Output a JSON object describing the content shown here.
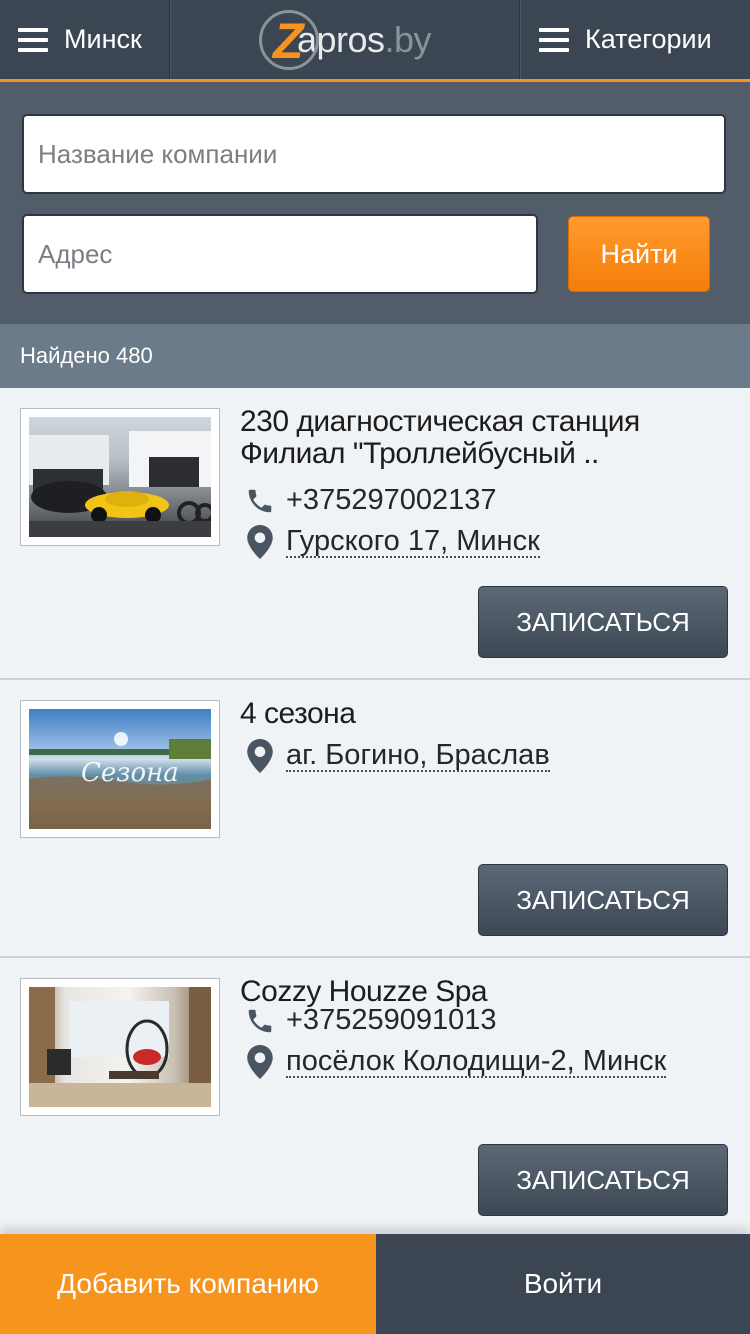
{
  "header": {
    "city_label": "Минск",
    "logo_z": "Z",
    "logo_text": "apros",
    "logo_domain": ".by",
    "categories_label": "Категории"
  },
  "search": {
    "name_placeholder": "Название компании",
    "address_placeholder": "Адрес",
    "find_label": "Найти"
  },
  "results": {
    "found_label": "Найдено 480"
  },
  "companies": [
    {
      "title": "230 диагностическая станция Филиал \"Троллейбусный ..",
      "phone": "+375297002137",
      "address": "Гурского 17, Минск",
      "button": "ЗАПИСАТЬСЯ"
    },
    {
      "title": "4 сезона",
      "address": "аг. Богино, Браслав",
      "button": "ЗАПИСАТЬСЯ",
      "image_caption": "Сезона"
    },
    {
      "title": "Cozzy Houzze Spa",
      "phone": "+375259091013",
      "address": "посёлок Колодищи-2, Минск",
      "button": "ЗАПИСАТЬСЯ"
    }
  ],
  "footer": {
    "add_company": "Добавить компанию",
    "login": "Войти"
  },
  "colors": {
    "header_bg": "#3c4652",
    "accent": "#f7941d",
    "search_bg": "#525d69",
    "found_bar": "#6c7b8a",
    "button_dark": "#4a5562"
  }
}
